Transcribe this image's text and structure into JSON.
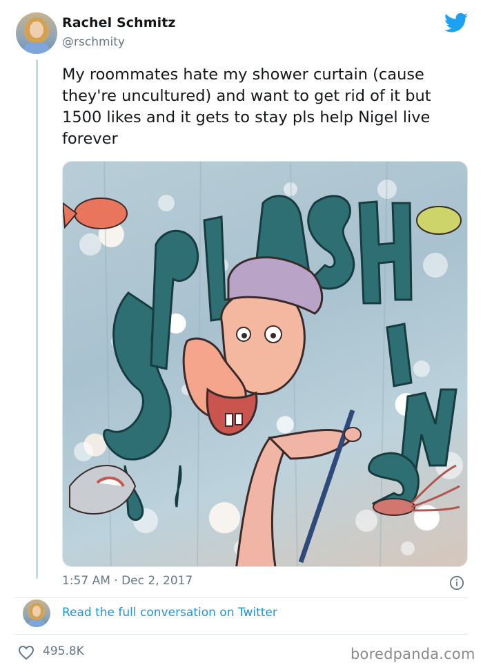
{
  "author": {
    "name": "Rachel Schmitz",
    "handle": "@rschmity",
    "avatar_icon": "user-avatar-icon"
  },
  "tweet": {
    "text": "My roommates hate my shower curtain (cause they're uncultured) and want to get rid of it but 1500 likes and it gets to stay pls help Nigel live forever",
    "timestamp": "1:57 AM · Dec 2, 2017",
    "media_description_icon": "photo-icon"
  },
  "conversation": {
    "link_label": "Read the full conversation on Twitter"
  },
  "engagement": {
    "likes": "495.8K"
  },
  "watermark": "boredpanda.com",
  "colors": {
    "twitter_blue": "#1da1f2",
    "link_blue": "#1b95e0",
    "muted": "#657786",
    "text": "#14171a",
    "divider": "#e1e8ed"
  }
}
